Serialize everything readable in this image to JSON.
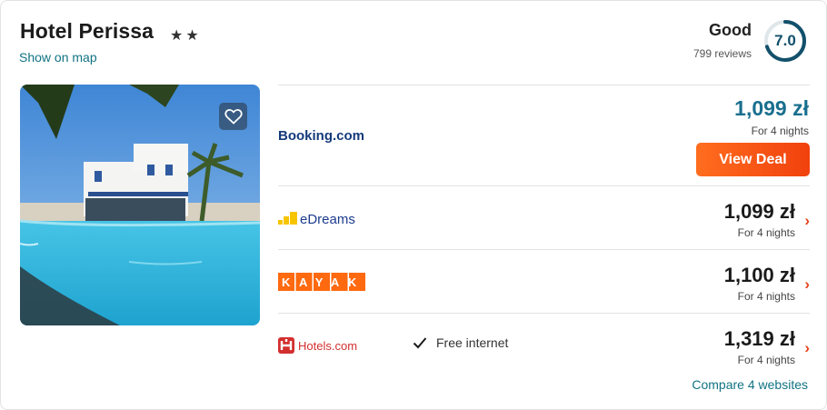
{
  "hotel": {
    "name": "Hotel Perissa",
    "stars": "★★",
    "map_link": "Show on map"
  },
  "rating": {
    "label": "Good",
    "reviews": "799 reviews",
    "score": "7.0",
    "score_fraction": 0.7,
    "ring_color": "#12506b"
  },
  "deals": [
    {
      "provider": "Booking.com",
      "price": "1,099 zł",
      "nights": "For 4 nights",
      "button": "View Deal"
    },
    {
      "provider": "eDreams",
      "price": "1,099 zł",
      "nights": "For 4 nights"
    },
    {
      "provider": "KAYAK",
      "price": "1,100 zł",
      "nights": "For 4 nights"
    },
    {
      "provider": "Hotels.com",
      "price": "1,319 zł",
      "nights": "For 4 nights",
      "amenity": "Free internet"
    }
  ],
  "compare_link": "Compare 4 websites",
  "colors": {
    "accent": "#117383",
    "deal_button": "#f1410d",
    "chevron": "#e6431c"
  }
}
